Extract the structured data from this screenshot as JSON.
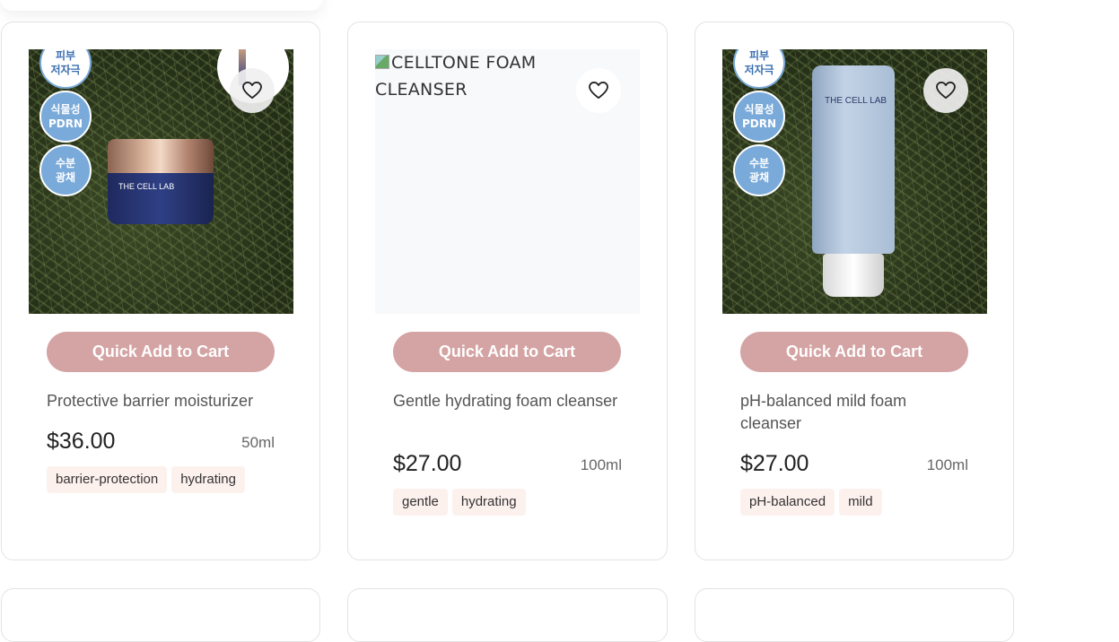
{
  "products": [
    {
      "image_alt": "CELLTONE CREAM",
      "badges": [
        "피부\n저자극",
        "식물성\nPDRN",
        "수분\n광채"
      ],
      "product_label": "THE CELL LAB",
      "add_label": "Quick Add to Cart",
      "description": "Protective barrier moisturizer",
      "price": "$36.00",
      "size": "50ml",
      "tags": [
        "barrier-protection",
        "hydrating"
      ]
    },
    {
      "image_alt": "CELLTONE FOAM CLEANSER",
      "add_label": "Quick Add to Cart",
      "description": "Gentle hydrating foam cleanser",
      "price": "$27.00",
      "size": "100ml",
      "tags": [
        "gentle",
        "hydrating"
      ]
    },
    {
      "image_alt": "CELLTONE FOAM CLEANSER",
      "badges": [
        "피부\n저자극",
        "식물성\nPDRN",
        "수분\n광채"
      ],
      "product_label": "THE CELL LAB",
      "add_label": "Quick Add to Cart",
      "description": "pH-balanced mild foam cleanser",
      "price": "$27.00",
      "size": "100ml",
      "tags": [
        "pH-balanced",
        "mild"
      ]
    }
  ],
  "colors": {
    "accent": "#d4a3a3",
    "tag_bg": "#fdf1ee",
    "badge_blue": "#7aaad9"
  },
  "icons": {
    "favorite": "heart-outline-icon"
  }
}
